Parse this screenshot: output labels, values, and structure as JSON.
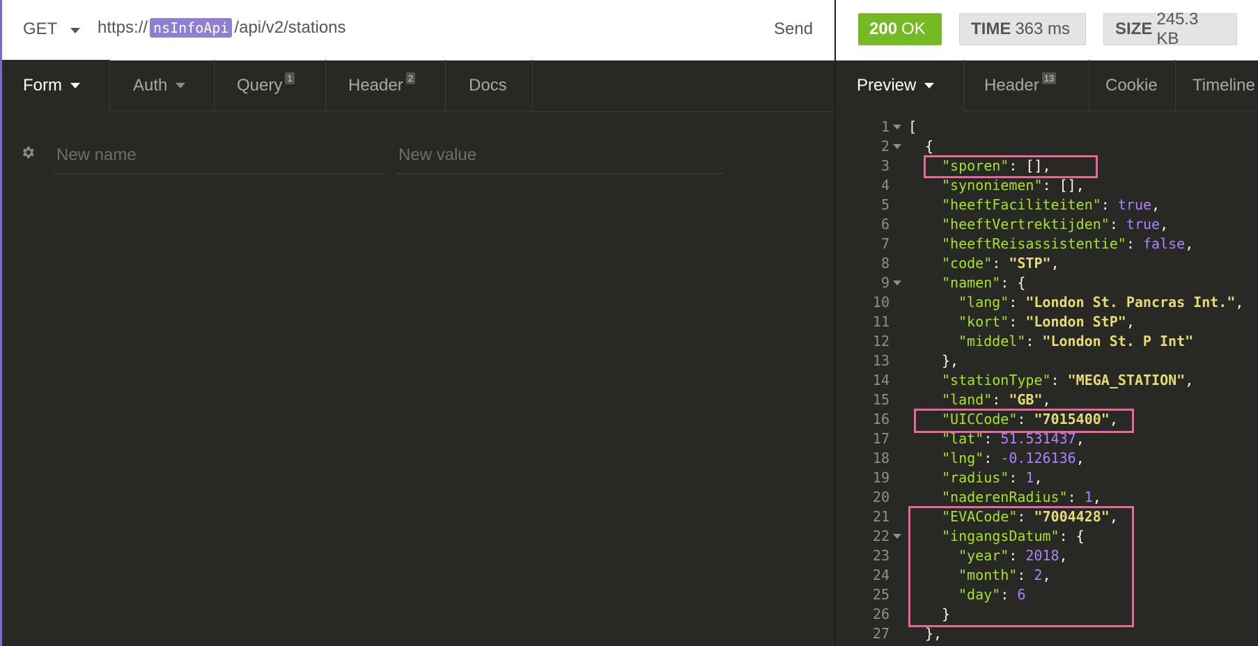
{
  "request": {
    "method": "GET",
    "url_prefix": "https://",
    "url_variable": "nsInfoApi",
    "url_suffix": "/api/v2/stations",
    "send_label": "Send"
  },
  "request_tabs": [
    {
      "label": "Form",
      "badge": ""
    },
    {
      "label": "Auth",
      "badge": ""
    },
    {
      "label": "Query",
      "badge": "1"
    },
    {
      "label": "Header",
      "badge": "2"
    },
    {
      "label": "Docs",
      "badge": ""
    }
  ],
  "form": {
    "name_placeholder": "New name",
    "value_placeholder": "New value"
  },
  "response": {
    "status_code": "200",
    "status_text": "OK",
    "time_label": "TIME",
    "time_value": "363 ms",
    "size_label": "SIZE",
    "size_value": "245.3 KB"
  },
  "response_tabs": [
    {
      "label": "Preview",
      "badge": ""
    },
    {
      "label": "Header",
      "badge": "13"
    },
    {
      "label": "Cookie",
      "badge": ""
    },
    {
      "label": "Timeline",
      "badge": ""
    }
  ],
  "code_lines": [
    {
      "n": "1",
      "fold": true,
      "indent": 0,
      "parts": [
        [
          "p",
          "["
        ]
      ]
    },
    {
      "n": "2",
      "fold": true,
      "indent": 1,
      "parts": [
        [
          "p",
          "{"
        ]
      ]
    },
    {
      "n": "3",
      "fold": false,
      "indent": 2,
      "parts": [
        [
          "k",
          "\"sporen\""
        ],
        [
          "p",
          ": [],"
        ]
      ]
    },
    {
      "n": "4",
      "fold": false,
      "indent": 2,
      "parts": [
        [
          "k",
          "\"synoniemen\""
        ],
        [
          "p",
          ": [],"
        ]
      ]
    },
    {
      "n": "5",
      "fold": false,
      "indent": 2,
      "parts": [
        [
          "k",
          "\"heeftFaciliteiten\""
        ],
        [
          "p",
          ": "
        ],
        [
          "b",
          "true"
        ],
        [
          "p",
          ","
        ]
      ]
    },
    {
      "n": "6",
      "fold": false,
      "indent": 2,
      "parts": [
        [
          "k",
          "\"heeftVertrektijden\""
        ],
        [
          "p",
          ": "
        ],
        [
          "b",
          "true"
        ],
        [
          "p",
          ","
        ]
      ]
    },
    {
      "n": "7",
      "fold": false,
      "indent": 2,
      "parts": [
        [
          "k",
          "\"heeftReisassistentie\""
        ],
        [
          "p",
          ": "
        ],
        [
          "b",
          "false"
        ],
        [
          "p",
          ","
        ]
      ]
    },
    {
      "n": "8",
      "fold": false,
      "indent": 2,
      "parts": [
        [
          "k",
          "\"code\""
        ],
        [
          "p",
          ": "
        ],
        [
          "s",
          "\"STP\""
        ],
        [
          "p",
          ","
        ]
      ]
    },
    {
      "n": "9",
      "fold": true,
      "indent": 2,
      "parts": [
        [
          "k",
          "\"namen\""
        ],
        [
          "p",
          ": {"
        ]
      ]
    },
    {
      "n": "10",
      "fold": false,
      "indent": 3,
      "parts": [
        [
          "k",
          "\"lang\""
        ],
        [
          "p",
          ": "
        ],
        [
          "s",
          "\"London St. Pancras Int.\""
        ],
        [
          "p",
          ","
        ]
      ]
    },
    {
      "n": "11",
      "fold": false,
      "indent": 3,
      "parts": [
        [
          "k",
          "\"kort\""
        ],
        [
          "p",
          ": "
        ],
        [
          "s",
          "\"London StP\""
        ],
        [
          "p",
          ","
        ]
      ]
    },
    {
      "n": "12",
      "fold": false,
      "indent": 3,
      "parts": [
        [
          "k",
          "\"middel\""
        ],
        [
          "p",
          ": "
        ],
        [
          "s",
          "\"London St. P Int\""
        ]
      ]
    },
    {
      "n": "13",
      "fold": false,
      "indent": 2,
      "parts": [
        [
          "p",
          "},"
        ]
      ]
    },
    {
      "n": "14",
      "fold": false,
      "indent": 2,
      "parts": [
        [
          "k",
          "\"stationType\""
        ],
        [
          "p",
          ": "
        ],
        [
          "s",
          "\"MEGA_STATION\""
        ],
        [
          "p",
          ","
        ]
      ]
    },
    {
      "n": "15",
      "fold": false,
      "indent": 2,
      "parts": [
        [
          "k",
          "\"land\""
        ],
        [
          "p",
          ": "
        ],
        [
          "s",
          "\"GB\""
        ],
        [
          "p",
          ","
        ]
      ]
    },
    {
      "n": "16",
      "fold": false,
      "indent": 2,
      "parts": [
        [
          "k",
          "\"UICCode\""
        ],
        [
          "p",
          ": "
        ],
        [
          "s",
          "\"7015400\""
        ],
        [
          "p",
          ","
        ]
      ]
    },
    {
      "n": "17",
      "fold": false,
      "indent": 2,
      "parts": [
        [
          "k",
          "\"lat\""
        ],
        [
          "p",
          ": "
        ],
        [
          "b",
          "51.531437"
        ],
        [
          "p",
          ","
        ]
      ]
    },
    {
      "n": "18",
      "fold": false,
      "indent": 2,
      "parts": [
        [
          "k",
          "\"lng\""
        ],
        [
          "p",
          ": "
        ],
        [
          "b",
          "-0.126136"
        ],
        [
          "p",
          ","
        ]
      ]
    },
    {
      "n": "19",
      "fold": false,
      "indent": 2,
      "parts": [
        [
          "k",
          "\"radius\""
        ],
        [
          "p",
          ": "
        ],
        [
          "b",
          "1"
        ],
        [
          "p",
          ","
        ]
      ]
    },
    {
      "n": "20",
      "fold": false,
      "indent": 2,
      "parts": [
        [
          "k",
          "\"naderenRadius\""
        ],
        [
          "p",
          ": "
        ],
        [
          "b",
          "1"
        ],
        [
          "p",
          ","
        ]
      ]
    },
    {
      "n": "21",
      "fold": false,
      "indent": 2,
      "parts": [
        [
          "k",
          "\"EVACode\""
        ],
        [
          "p",
          ": "
        ],
        [
          "s",
          "\"7004428\""
        ],
        [
          "p",
          ","
        ]
      ]
    },
    {
      "n": "22",
      "fold": true,
      "indent": 2,
      "parts": [
        [
          "k",
          "\"ingangsDatum\""
        ],
        [
          "p",
          ": {"
        ]
      ]
    },
    {
      "n": "23",
      "fold": false,
      "indent": 3,
      "parts": [
        [
          "k",
          "\"year\""
        ],
        [
          "p",
          ": "
        ],
        [
          "b",
          "2018"
        ],
        [
          "p",
          ","
        ]
      ]
    },
    {
      "n": "24",
      "fold": false,
      "indent": 3,
      "parts": [
        [
          "k",
          "\"month\""
        ],
        [
          "p",
          ": "
        ],
        [
          "b",
          "2"
        ],
        [
          "p",
          ","
        ]
      ]
    },
    {
      "n": "25",
      "fold": false,
      "indent": 3,
      "parts": [
        [
          "k",
          "\"day\""
        ],
        [
          "p",
          ": "
        ],
        [
          "b",
          "6"
        ]
      ]
    },
    {
      "n": "26",
      "fold": false,
      "indent": 2,
      "parts": [
        [
          "p",
          "}"
        ]
      ]
    },
    {
      "n": "27",
      "fold": false,
      "indent": 1,
      "parts": [
        [
          "p",
          "},"
        ]
      ]
    }
  ],
  "colors": {
    "ok_green": "#75ba24",
    "json_key": "#a6e22e",
    "json_string": "#e6db74",
    "json_number": "#ae81ff",
    "highlight_box": "#e9679b",
    "variable_tag": "#8e7fd2"
  }
}
